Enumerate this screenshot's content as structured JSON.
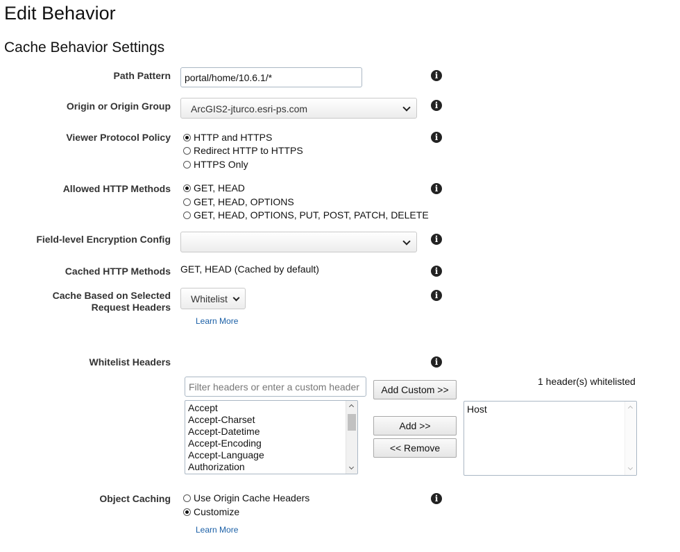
{
  "page": {
    "title": "Edit Behavior",
    "section_title": "Cache Behavior Settings"
  },
  "icons": {
    "info": "info-circle-icon",
    "dropdown": "chevron-down-icon"
  },
  "fields": {
    "path_pattern": {
      "label": "Path Pattern",
      "value": "portal/home/10.6.1/*"
    },
    "origin": {
      "label": "Origin or Origin Group",
      "value": "ArcGIS2-jturco.esri-ps.com"
    },
    "viewer_protocol": {
      "label": "Viewer Protocol Policy",
      "options": [
        "HTTP and HTTPS",
        "Redirect HTTP to HTTPS",
        "HTTPS Only"
      ],
      "selected": "HTTP and HTTPS"
    },
    "allowed_methods": {
      "label": "Allowed HTTP Methods",
      "options": [
        "GET, HEAD",
        "GET, HEAD, OPTIONS",
        "GET, HEAD, OPTIONS, PUT, POST, PATCH, DELETE"
      ],
      "selected": "GET, HEAD"
    },
    "field_encryption": {
      "label": "Field-level Encryption Config",
      "value": ""
    },
    "cached_methods": {
      "label": "Cached HTTP Methods",
      "value": "GET, HEAD (Cached by default)"
    },
    "cache_headers": {
      "label_line1": "Cache Based on Selected",
      "label_line2": "Request Headers",
      "value": "Whitelist",
      "learn_more": "Learn More"
    },
    "whitelist_headers": {
      "label": "Whitelist Headers",
      "filter_placeholder": "Filter headers or enter a custom header",
      "available": [
        "Accept",
        "Accept-Charset",
        "Accept-Datetime",
        "Accept-Encoding",
        "Accept-Language",
        "Authorization"
      ],
      "add_custom_label": "Add Custom >>",
      "add_label": "Add >>",
      "remove_label": "<< Remove",
      "count_text": "1 header(s) whitelisted",
      "selected": [
        "Host"
      ]
    },
    "object_caching": {
      "label": "Object Caching",
      "options": [
        "Use Origin Cache Headers",
        "Customize"
      ],
      "selected": "Customize",
      "learn_more": "Learn More"
    }
  }
}
